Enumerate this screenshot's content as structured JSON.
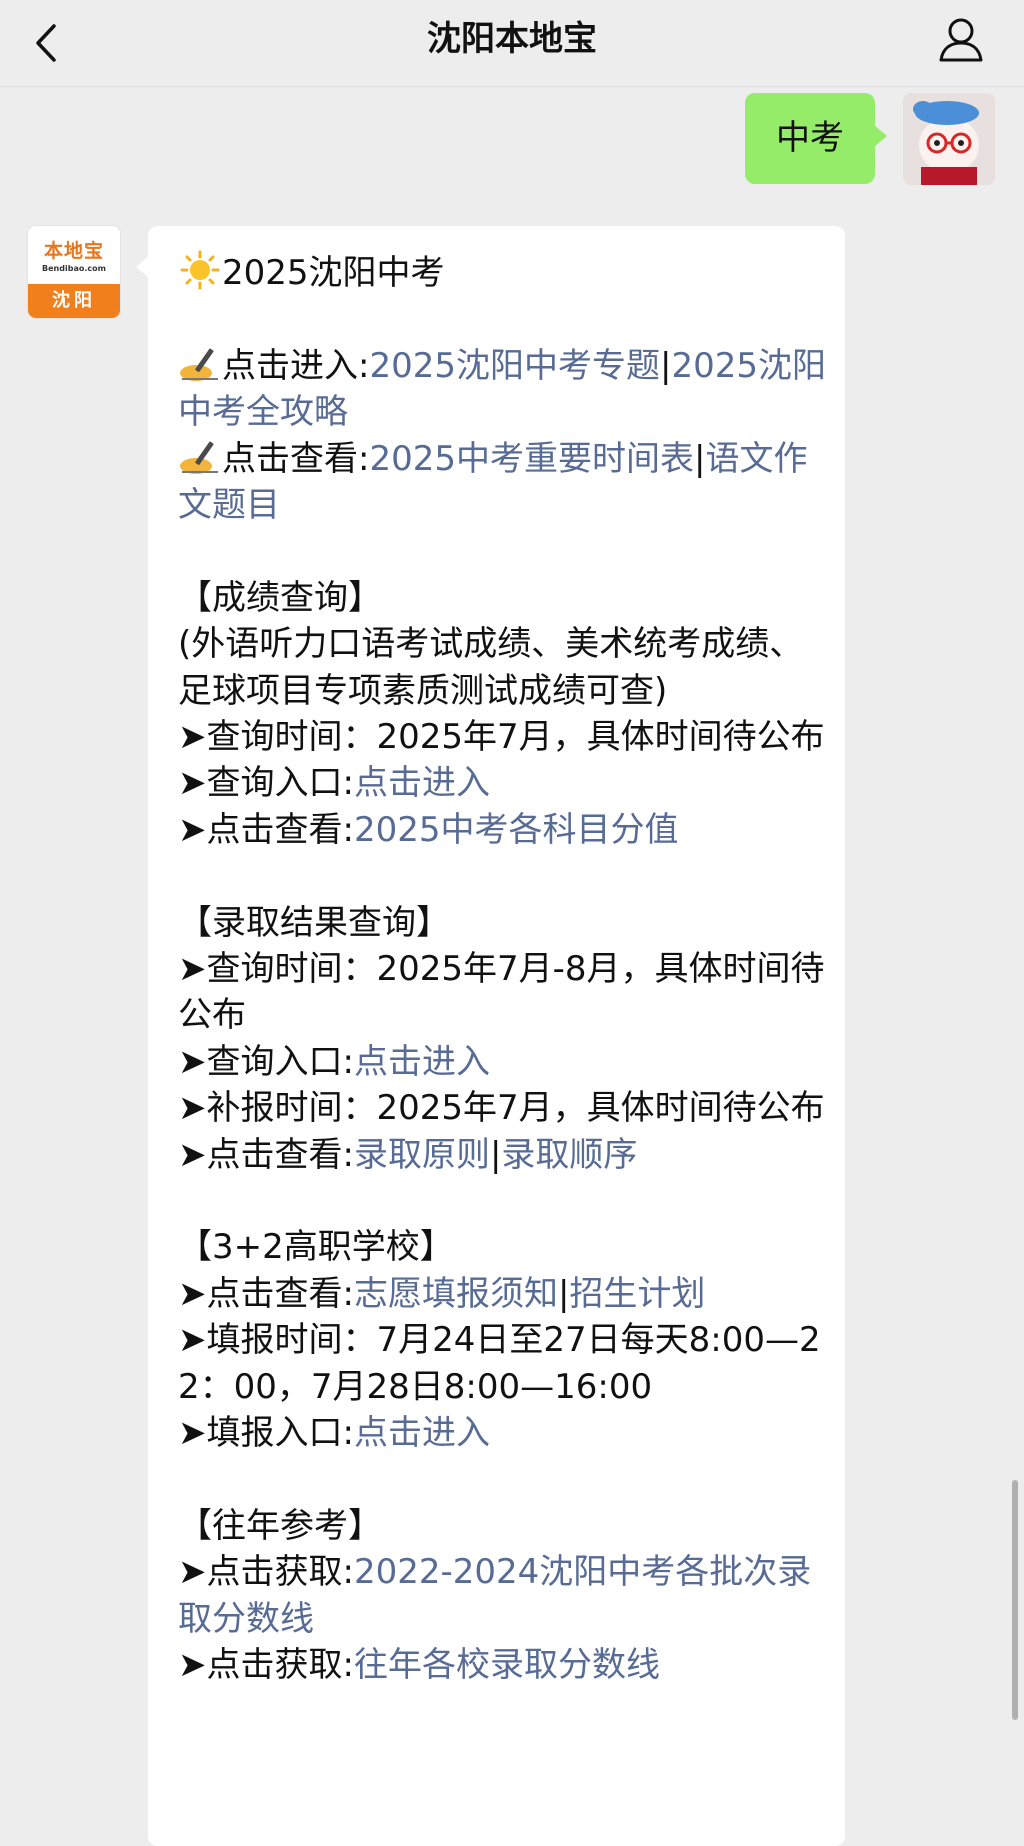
{
  "header": {
    "title": "沈阳本地宝"
  },
  "user_message": {
    "text": "中考"
  },
  "bot_avatar": {
    "brand": "本地宝",
    "brand_sub": "Bendibao.com",
    "city": "沈阳"
  },
  "article": {
    "title": "2025沈阳中考",
    "enter": {
      "label": "点击进入:",
      "link1": "2025沈阳中考专题",
      "sep": "|",
      "link2": "2025沈阳中考全攻略"
    },
    "view": {
      "label": "点击查看:",
      "link1": "2025中考重要时间表",
      "sep": "|",
      "link2": "语文作文题目"
    },
    "scores": {
      "heading": "【成绩查询】",
      "note": "(外语听力口语考试成绩、美术统考成绩、足球项目专项素质测试成绩可查)",
      "time": "➤查询时间：2025年7月，具体时间待公布",
      "entry_label": "➤查询入口:",
      "entry_link": "点击进入",
      "view_label": "➤点击查看:",
      "view_link": "2025中考各科目分值"
    },
    "admission": {
      "heading": "【录取结果查询】",
      "time": "➤查询时间：2025年7月-8月，具体时间待公布",
      "entry_label": "➤查询入口:",
      "entry_link": "点击进入",
      "supp": "➤补报时间：2025年7月，具体时间待公布",
      "view_label": "➤点击查看:",
      "view_link1": "录取原则",
      "sep": "|",
      "view_link2": "录取顺序"
    },
    "vocational": {
      "heading": "【3+2高职学校】",
      "view_label": "➤点击查看:",
      "view_link1": "志愿填报须知",
      "sep": "|",
      "view_link2": "招生计划",
      "fill_time": "➤填报时间：7月24日至27日每天8:00—22：00，7月28日8:00—16:00",
      "entry_label": "➤填报入口:",
      "entry_link": "点击进入"
    },
    "past": {
      "heading": "【往年参考】",
      "get1_label": "➤点击获取:",
      "get1_link": "2022-2024沈阳中考各批次录取分数线",
      "get2_label": "➤点击获取:",
      "get2_link": "往年各校录取分数线"
    }
  },
  "colors": {
    "link": "#576b95",
    "user_bubble": "#95ec69",
    "background": "#ededed",
    "brand_orange": "#f07f1c"
  }
}
